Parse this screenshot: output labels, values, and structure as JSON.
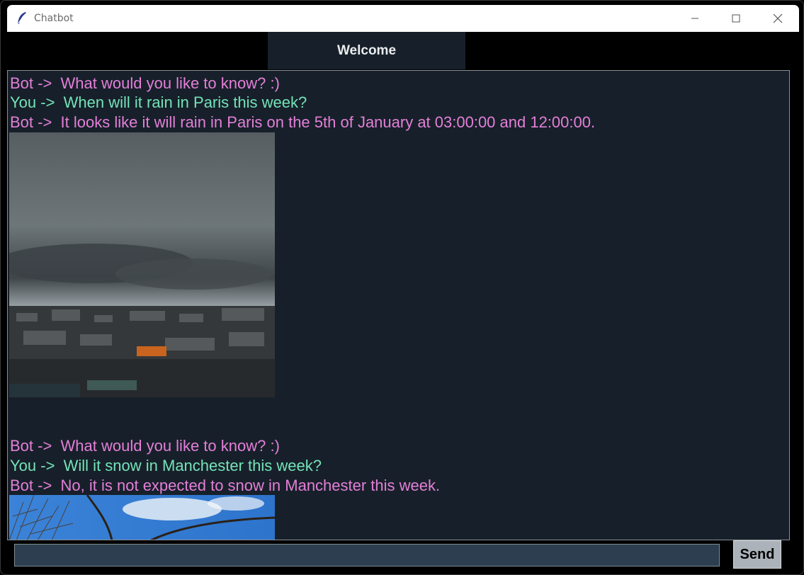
{
  "window": {
    "title": "Chatbot",
    "icon": "feather-icon"
  },
  "header": {
    "title": "Welcome"
  },
  "chat": {
    "messages": [
      {
        "sender": "Bot ->",
        "text": "  What would you like to know? :)",
        "full": "Bot ->  What would you like to know? :)"
      },
      {
        "sender": "You ->",
        "full": "You ->  When will it rain in Paris this week?"
      },
      {
        "sender": "Bot ->",
        "full": "Bot ->  It looks like it will rain in Paris on the 5th of January at 03:00:00 and 12:00:00."
      },
      {
        "sender": "Bot ->",
        "full": "Bot ->  What would you like to know? :)"
      },
      {
        "sender": "You ->",
        "full": "You ->  Will it snow in Manchester this week?"
      },
      {
        "sender": "Bot ->",
        "full": "Bot ->  No, it is not expected to snow in Manchester this week."
      }
    ],
    "images": [
      {
        "name": "paris-rain-photo",
        "description_icon": "cloudy-city-image"
      },
      {
        "name": "manchester-sky-photo",
        "description_icon": "blue-sky-branches-image"
      }
    ]
  },
  "input": {
    "value": "",
    "send_label": "Send"
  },
  "colors": {
    "window_bg": "#000000",
    "chat_bg": "#17202a",
    "bot_text": "#e47fd8",
    "user_text": "#74e3b8",
    "entry_bg": "#2c3e50",
    "button_bg": "#abb2b9",
    "header_text": "#eaecee"
  }
}
